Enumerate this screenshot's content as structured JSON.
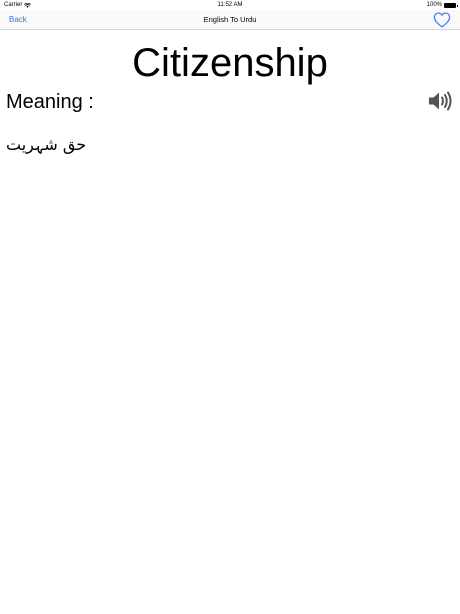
{
  "status_bar": {
    "carrier": "Carrier",
    "time": "11:52 AM",
    "battery": "100%"
  },
  "nav": {
    "back_label": "Back",
    "title": "English To Urdu"
  },
  "word": "Citizenship",
  "meaning_label": "Meaning :",
  "meaning_text": "حق شہریت",
  "colors": {
    "accent": "#2f7cf6"
  },
  "icons": {
    "wifi": "wifi-icon",
    "battery": "battery-icon",
    "favorite": "heart-icon",
    "speaker": "speaker-icon"
  }
}
